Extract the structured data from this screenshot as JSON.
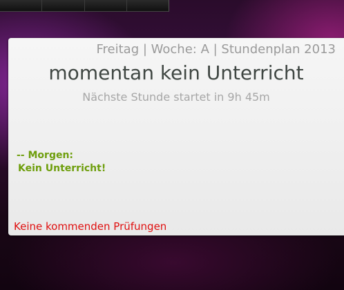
{
  "top_bar": {
    "segments": 4
  },
  "widget": {
    "header": "Freitag | Woche: A | Stundenplan 2013",
    "status": "momentan kein Unterricht",
    "next_lesson": "Nächste Stunde startet in 9h 45m",
    "tomorrow_heading": "-- Morgen:",
    "tomorrow_text": "Kein Unterricht!",
    "exams": "Keine kommenden Prüfungen"
  },
  "colors": {
    "header": "#9a9a9a",
    "status": "#3f4642",
    "next_lesson": "#a6a6a6",
    "tomorrow": "#6e9e0c",
    "exams": "#e01010"
  }
}
